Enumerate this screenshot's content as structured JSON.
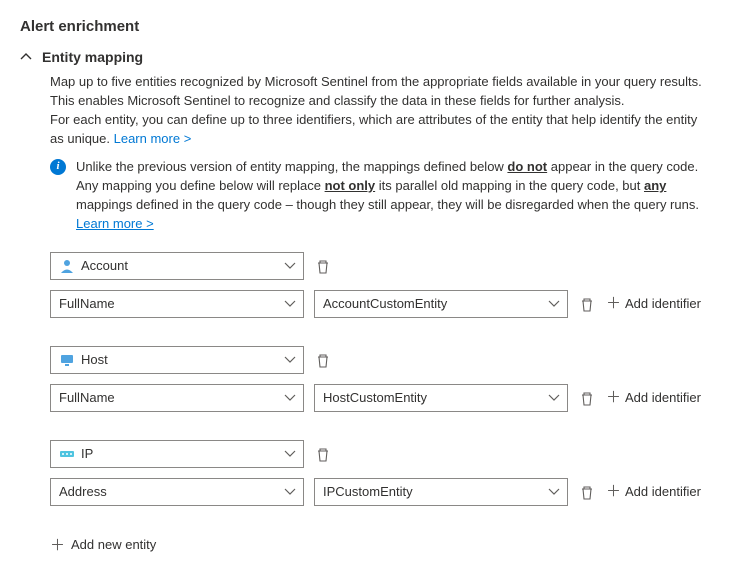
{
  "title": "Alert enrichment",
  "section": {
    "title": "Entity mapping",
    "desc_1": "Map up to five entities recognized by Microsoft Sentinel from the appropriate fields available in your query results. This enables Microsoft Sentinel to recognize and classify the data in these fields for further analysis.",
    "desc_2a": "For each entity, you can define up to three identifiers, which are attributes of the entity that help identify the entity as unique. ",
    "learn_more": "Learn more >",
    "info_1": "Unlike the previous version of entity mapping, the mappings defined below ",
    "info_bold1": "do not",
    "info_2": " appear in the query code. Any mapping you define below will replace ",
    "info_bold2": "not only",
    "info_3": " its parallel old mapping in the query code, but ",
    "info_bold3": "any",
    "info_4": " mappings defined in the query code – though they still appear, they will be disregarded when the query runs. ",
    "info_learn": "Learn more >"
  },
  "entities": [
    {
      "type": "Account",
      "identifier": "FullName",
      "value": "AccountCustomEntity",
      "icon": "account"
    },
    {
      "type": "Host",
      "identifier": "FullName",
      "value": "HostCustomEntity",
      "icon": "host"
    },
    {
      "type": "IP",
      "identifier": "Address",
      "value": "IPCustomEntity",
      "icon": "ip"
    }
  ],
  "labels": {
    "add_identifier": "Add identifier",
    "add_entity": "Add new entity"
  }
}
